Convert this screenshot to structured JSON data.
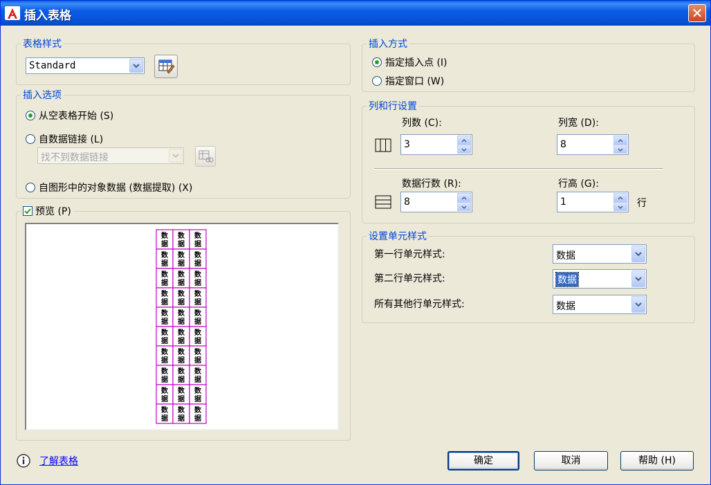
{
  "window": {
    "title": "插入表格"
  },
  "table_style": {
    "group_label": "表格样式",
    "selected": "Standard"
  },
  "insert_options": {
    "group_label": "插入选项",
    "option_empty": "从空表格开始 (S)",
    "option_data_link": "自数据链接 (L)",
    "data_link_value": "找不到数据链接",
    "option_extraction": "自图形中的对象数据 (数据提取) (X)"
  },
  "preview": {
    "label": "预览 (P)",
    "cell_text": "数据",
    "columns": 3,
    "rows": 10
  },
  "insert_method": {
    "group_label": "插入方式",
    "option_point": "指定插入点 (I)",
    "option_window": "指定窗口 (W)"
  },
  "columns_rows": {
    "group_label": "列和行设置",
    "columns_label": "列数 (C):",
    "columns_value": "3",
    "column_width_label": "列宽 (D):",
    "column_width_value": "8",
    "data_rows_label": "数据行数 (R):",
    "data_rows_value": "8",
    "row_height_label": "行高 (G):",
    "row_height_value": "1",
    "row_unit": "行"
  },
  "cell_styles": {
    "group_label": "设置单元样式",
    "first_row_label": "第一行单元样式:",
    "first_row_value": "数据",
    "second_row_label": "第二行单元样式:",
    "second_row_value": "数据",
    "other_rows_label": "所有其他行单元样式:",
    "other_rows_value": "数据"
  },
  "footer": {
    "learn_link": "了解表格",
    "ok": "确定",
    "cancel": "取消",
    "help": "帮助 (H)"
  },
  "colors": {
    "legend": "#0046d5",
    "preview_grid": "#c000c0",
    "radio_dot": "#21a121"
  }
}
